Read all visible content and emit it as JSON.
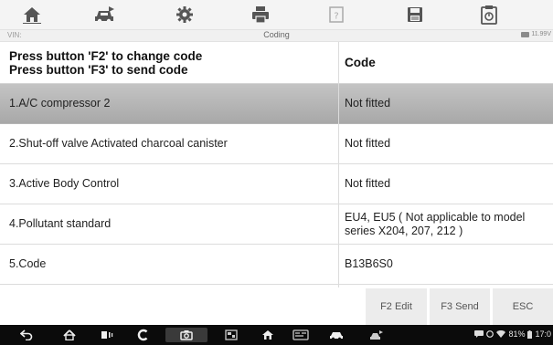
{
  "toolbar": {
    "buttons": [
      {
        "name": "home-icon"
      },
      {
        "name": "vehicle-swap-icon"
      },
      {
        "name": "settings-gear-icon"
      },
      {
        "name": "print-icon"
      },
      {
        "name": "help-icon"
      },
      {
        "name": "save-icon"
      },
      {
        "name": "data-logging-icon"
      }
    ]
  },
  "infobar": {
    "vin_label": "VIN:",
    "title": "Coding",
    "voltage": "11.99V"
  },
  "table": {
    "header_left_line1": "Press button 'F2' to change code",
    "header_left_line2": "Press button 'F3' to send code",
    "header_right": "Code",
    "rows": [
      {
        "name": "1.A/C compressor 2",
        "value": "Not fitted"
      },
      {
        "name": "2.Shut-off valve Activated charcoal canister",
        "value": "Not fitted"
      },
      {
        "name": "3.Active Body Control",
        "value": "Not fitted"
      },
      {
        "name": "4.Pollutant standard",
        "value": "EU4, EU5 ( Not applicable to model series X204, 207, 212 )"
      },
      {
        "name": "5.Code",
        "value": "B13B6S0"
      }
    ]
  },
  "function_buttons": {
    "f2": "F2 Edit",
    "f3": "F3 Send",
    "esc": "ESC"
  },
  "system_bar": {
    "battery": "81%",
    "time": "17:0"
  },
  "colors": {
    "selected_row": "#b4b4b4",
    "toolbar_icon": "#555555",
    "nav_bar": "#0b0b0b"
  }
}
